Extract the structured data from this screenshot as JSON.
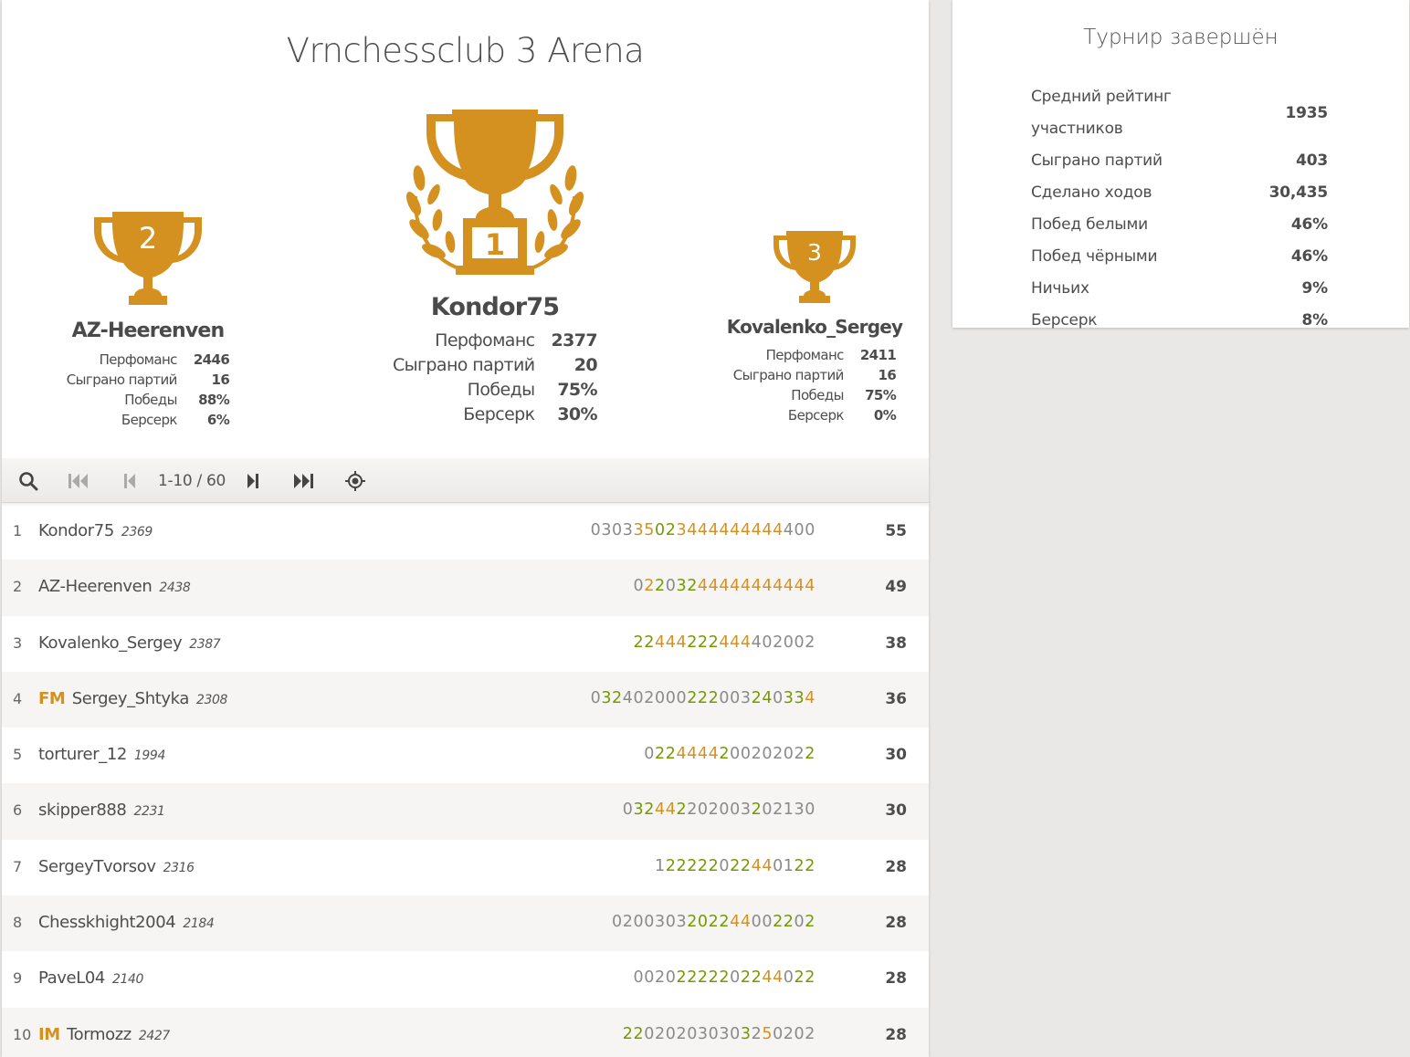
{
  "tournament": {
    "name": "Vrnchessclub 3 Arena"
  },
  "podium": {
    "first": {
      "rank": "1",
      "name": "Kondor75",
      "stats": [
        {
          "label": "Перфоманс",
          "value": "2377"
        },
        {
          "label": "Сыграно партий",
          "value": "20"
        },
        {
          "label": "Победы",
          "value": "75%"
        },
        {
          "label": "Берсерк",
          "value": "30%"
        }
      ]
    },
    "second": {
      "rank": "2",
      "name": "AZ-Heerenven",
      "stats": [
        {
          "label": "Перфоманс",
          "value": "2446"
        },
        {
          "label": "Сыграно партий",
          "value": "16"
        },
        {
          "label": "Победы",
          "value": "88%"
        },
        {
          "label": "Берсерк",
          "value": "6%"
        }
      ]
    },
    "third": {
      "rank": "3",
      "name": "Kovalenko_Sergey",
      "stats": [
        {
          "label": "Перфоманс",
          "value": "2411"
        },
        {
          "label": "Сыграно партий",
          "value": "16"
        },
        {
          "label": "Победы",
          "value": "75%"
        },
        {
          "label": "Берсерк",
          "value": "0%"
        }
      ]
    }
  },
  "toolbar": {
    "pager": "1-10 / 60",
    "icons": [
      "search-icon",
      "first-page-icon",
      "prev-page-icon",
      "next-page-icon",
      "last-page-icon",
      "my-position-icon"
    ]
  },
  "standings": [
    {
      "rank": "1",
      "title": "",
      "name": "Kondor75",
      "rating": "2369",
      "sheet": "030335023444444444400",
      "colors": "ggggoowwoooooooooogg",
      "score": "55"
    },
    {
      "rank": "2",
      "title": "",
      "name": "AZ-Heerenven",
      "rating": "2438",
      "sheet": "02203244444444444",
      "colors": "gowgwwoooooooooooo",
      "score": "49"
    },
    {
      "rank": "3",
      "title": "",
      "name": "Kovalenko_Sergey",
      "rating": "2387",
      "sheet": "22444222444402002",
      "colors": "wwooowwwooogggggg",
      "score": "38"
    },
    {
      "rank": "4",
      "title": "FM",
      "name": "Sergey_Shtyka",
      "rating": "2308",
      "sheet": "03240200022200324033 4",
      "colors": "gwwggggggwwwgggwwgwwo",
      "score": "36"
    },
    {
      "rank": "5",
      "title": "",
      "name": "torturer_12",
      "rating": "1994",
      "sheet": "02244442002020 22",
      "colors": "gwwoooowgggggggww",
      "score": "30"
    },
    {
      "rank": "6",
      "title": "",
      "name": "skipper888",
      "rating": "2231",
      "sheet": "032442202003202130",
      "colors": "gwwoowggggggwggggg",
      "score": "30"
    },
    {
      "rank": "7",
      "title": "",
      "name": "SergeyTvorsov",
      "rating": "2316",
      "sheet": "1222220224401 22",
      "colors": "gwwwwwgwwooggww",
      "score": "28"
    },
    {
      "rank": "8",
      "title": "",
      "name": "Chesskhight2004",
      "rating": "2184",
      "sheet": "020030320224400220 2",
      "colors": "gggggggwwwwooggwwgw",
      "score": "28"
    },
    {
      "rank": "9",
      "title": "",
      "name": "PaveL04",
      "rating": "2140",
      "sheet": "0020222220224402 2",
      "colors": "ggggwwwwwgwwoogww",
      "score": "28"
    },
    {
      "rank": "10",
      "title": "IM",
      "name": "Tormozz",
      "rating": "2427",
      "sheet": "220202030303250202",
      "colors": "wwgggggggggwgogggg",
      "score": "28"
    }
  ],
  "summary": {
    "heading": "Турнир завершён",
    "rows": [
      {
        "label": "Средний рейтинг участников",
        "value": "1935"
      },
      {
        "label": "Сыграно партий",
        "value": "403"
      },
      {
        "label": "Сделано ходов",
        "value": "30,435"
      },
      {
        "label": "Побед белыми",
        "value": "46%"
      },
      {
        "label": "Побед чёрными",
        "value": "46%"
      },
      {
        "label": "Ничьих",
        "value": "9%"
      },
      {
        "label": "Берсерк",
        "value": "8%"
      }
    ]
  },
  "colors": {
    "trophy": "#d59120",
    "win": "#759900",
    "streak": "#d59120",
    "neutral": "#8a8a8a"
  }
}
